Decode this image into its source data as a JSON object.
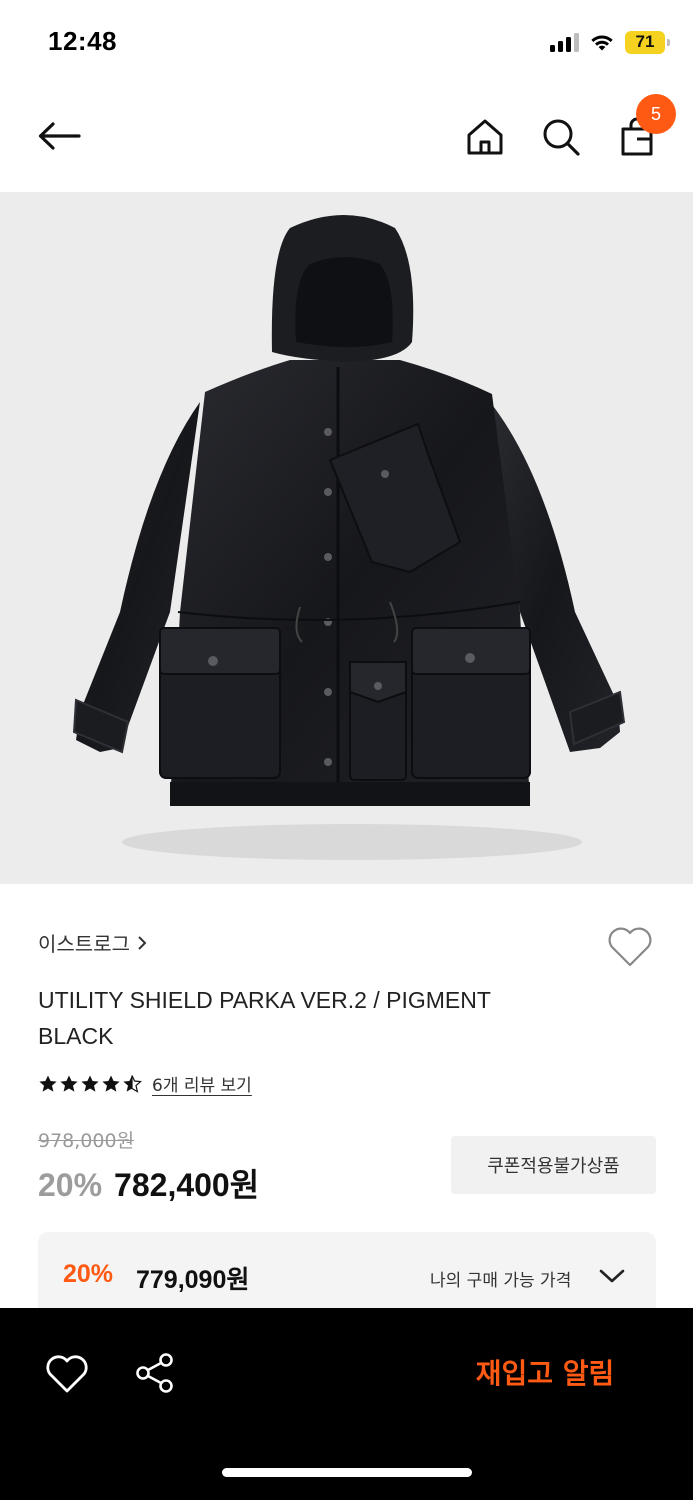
{
  "status_bar": {
    "time": "12:48",
    "battery": "71",
    "icons": [
      "signal-icon",
      "wifi-icon",
      "battery-icon"
    ],
    "battery_color": "#f4d21f"
  },
  "top_nav": {
    "icons": [
      "back-arrow-icon",
      "home-icon",
      "search-icon",
      "cart-icon"
    ],
    "cart_count": "5"
  },
  "product": {
    "brand": "이스트로그",
    "title_line1": "UTILITY SHIELD PARKA VER.2 / PIGMENT",
    "title_line2": "BLACK",
    "rating": 4.5,
    "review_link": "6개 리뷰 보기",
    "original_price": "978,000원",
    "discount_rate": "20%",
    "sale_price": "782,400원",
    "coupon_tag": "쿠폰적용불가상품",
    "image_description_icon": "parka-product-image"
  },
  "my_price": {
    "rate": "20%",
    "price": "779,090원",
    "label": "나의 구매 가능 가격"
  },
  "bottom_bar": {
    "restock_label": "재입고 알림",
    "icons": [
      "heart-icon",
      "share-icon"
    ]
  },
  "colors": {
    "accent": "#ff5a14",
    "bottom_bar": "#000000",
    "image_bg": "#ececec"
  }
}
